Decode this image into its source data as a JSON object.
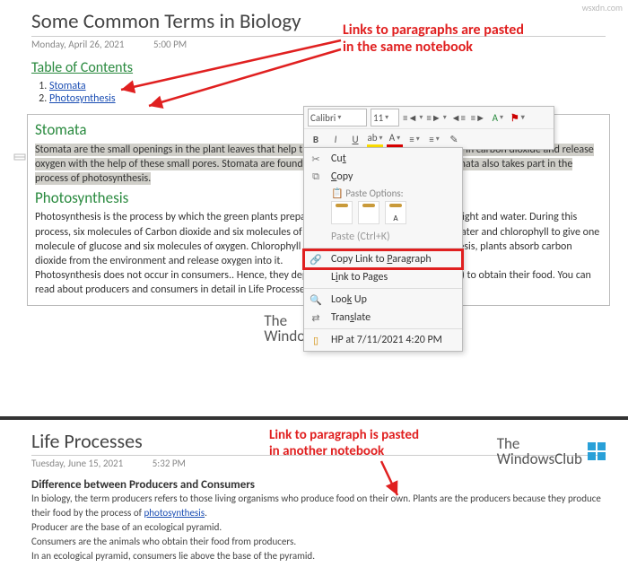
{
  "page1": {
    "title": "Some Common Terms in Biology",
    "date": "Monday, April 26, 2021",
    "time": "5:00 PM",
    "toc_title": "Table of Contents",
    "toc": [
      {
        "n": "1.",
        "label": "Stomata"
      },
      {
        "n": "2.",
        "label": "Photosynthesis"
      }
    ],
    "stomata_h": "Stomata",
    "stomata_p": "Stomata are the small openings in the plant leaves that help them exchange gases. The plants take in carbon dioxide and release oxygen with the help of these small pores. Stomata are found on the underside of the leaves. Stomata also takes part in the process of photosynthesis.",
    "photo_h": "Photosynthesis",
    "photo_p": "Photosynthesis is the process by which the green plants prepare their food in the presence of sunlight and water. During this process, six molecules of Carbon dioxide and six molecules of water combine in the presence of water and chlorophyll to give one molecule of glucose and six molecules of oxygen. Chlorophyll catalyzes the process of photosynthesis, plants absorb carbon dioxide from the environment and release oxygen into it.\nPhotosynthesis does not occur in consumers.. Hence, they depend on other organisms (producers) to obtain their food. You can read about producers and consumers in detail in Life Processes.",
    "annotation1_l1": "Links to paragraphs are pasted",
    "annotation1_l2": "in the same notebook",
    "brand_l1": "The",
    "brand_l2": "WindowsClub"
  },
  "toolbar": {
    "font": "Calibri",
    "size": "11"
  },
  "menu": {
    "cut": "Cut",
    "copy": "Copy",
    "paste_options": "Paste Options:",
    "paste_shortcut": "Paste (Ctrl+K)",
    "copy_link": "Copy Link to Paragraph",
    "link_pages": "Link to Pages",
    "lookup": "Look Up",
    "translate": "Translate",
    "hp": "HP at 7/11/2021 4:20 PM"
  },
  "page2": {
    "title": "Life Processes",
    "date": "Tuesday, June 15, 2021",
    "time": "5:32 PM",
    "annotation2_l1": "Link to paragraph is pasted",
    "annotation2_l2": "in another notebook",
    "subhead": "Difference between Producers and Consumers",
    "p1a": "In biology, the term producers refers to those living organisms who produce food on their own. Plants are the producers because they produce their food by the process of ",
    "p1_link": "photosynthesis",
    "p1b": ".",
    "p2": "Producer are the base of an ecological pyramid.",
    "p3": "Consumers are the animals who obtain their food from producers.",
    "p4": "In an ecological pyramid, consumers lie above the base of the pyramid.",
    "brand_l1": "The",
    "brand_l2": "WindowsClub",
    "watermark": "wsxdn.com"
  }
}
